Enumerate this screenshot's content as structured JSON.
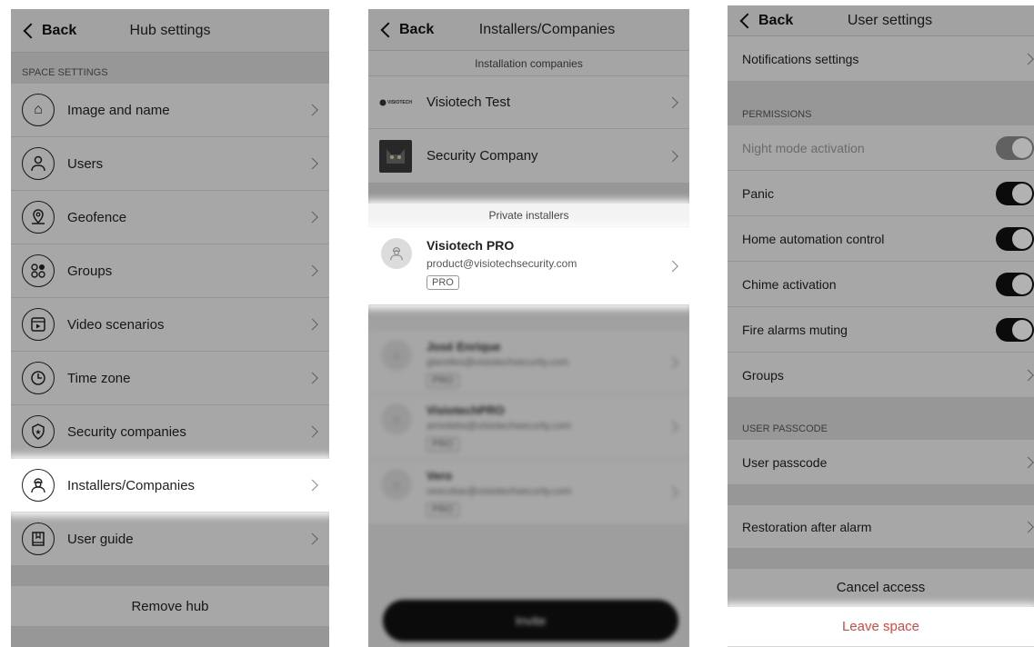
{
  "panel1": {
    "back_label": "Back",
    "title": "Hub settings",
    "section": "SPACE SETTINGS",
    "items": [
      {
        "label": "Image and name",
        "icon": "home-icon"
      },
      {
        "label": "Users",
        "icon": "user-icon"
      },
      {
        "label": "Geofence",
        "icon": "geofence-icon"
      },
      {
        "label": "Groups",
        "icon": "groups-icon"
      },
      {
        "label": "Video scenarios",
        "icon": "video-icon"
      },
      {
        "label": "Time zone",
        "icon": "clock-icon"
      },
      {
        "label": "Security companies",
        "icon": "shield-icon"
      },
      {
        "label": "Installers/Companies",
        "icon": "installer-icon"
      },
      {
        "label": "User guide",
        "icon": "book-icon"
      }
    ],
    "remove_label": "Remove hub"
  },
  "panel2": {
    "back_label": "Back",
    "title": "Installers/Companies",
    "companies_section": "Installation companies",
    "companies": [
      {
        "name": "Visiotech Test",
        "logo_text": "VISIOTECH"
      },
      {
        "name": "Security Company"
      }
    ],
    "private_section": "Private installers",
    "installers": [
      {
        "name": "Visiotech PRO",
        "email": "product@visiotechsecurity.com",
        "tag": "PRO"
      },
      {
        "name": "José Enrique",
        "email": "gtarelles@visiotechsecurity.com",
        "tag": "PRO"
      },
      {
        "name": "VisiotechPRO",
        "email": "amiolebs@visiotechsecurity.com",
        "tag": "PRO"
      },
      {
        "name": "Vero",
        "email": "vescobar@visiotechsecurity.com",
        "tag": "PRO"
      }
    ],
    "invite_label": "Invite"
  },
  "panel3": {
    "back_label": "Back",
    "title": "User settings",
    "notifications_label": "Notifications settings",
    "permissions_section": "PERMISSIONS",
    "permissions": [
      {
        "label": "Night mode activation",
        "enabled": true,
        "disabled": true
      },
      {
        "label": "Panic",
        "enabled": true
      },
      {
        "label": "Home automation control",
        "enabled": true
      },
      {
        "label": "Chime activation",
        "enabled": true
      },
      {
        "label": "Fire alarms muting",
        "enabled": true
      }
    ],
    "groups_label": "Groups",
    "passcode_section": "USER PASSCODE",
    "passcode_label": "User passcode",
    "restoration_label": "Restoration after alarm",
    "cancel_label": "Cancel access",
    "leave_label": "Leave space",
    "leave_color": "#e0443a"
  }
}
